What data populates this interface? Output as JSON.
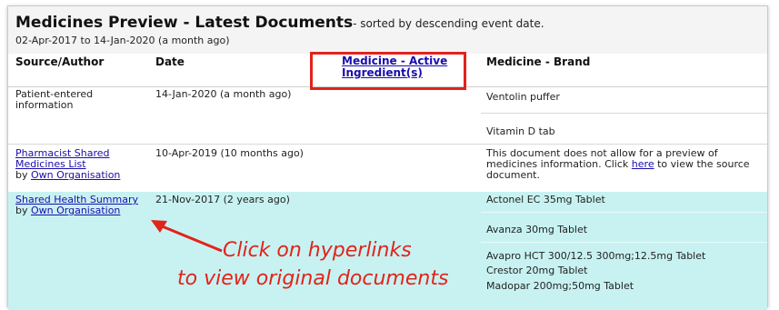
{
  "header": {
    "title": "Medicines Preview - Latest Documents",
    "subtitle": "- sorted by descending event date.",
    "date_range": "02-Apr-2017 to 14-Jan-2020 (a month ago)"
  },
  "columns": {
    "source_author": "Source/Author",
    "date": "Date",
    "active_ingredient_line1": "Medicine - Active",
    "active_ingredient_line2": "Ingredient(s)",
    "brand": "Medicine - Brand"
  },
  "rows": [
    {
      "source_line1": "Patient-entered",
      "source_line2": "information",
      "date": "14-Jan-2020 (a month ago)",
      "brands": [
        "Ventolin puffer",
        "Vitamin D tab"
      ]
    },
    {
      "source_link_line1": "Pharmacist Shared",
      "source_link_line2": "Medicines List",
      "by": "by",
      "org_link": "Own Organisation",
      "date": "10-Apr-2019 (10 months ago)",
      "note_line1": "This document does not allow for a preview of",
      "note_line2_a": "medicines information. Click",
      "note_link": "here",
      "note_line2_b": "to view the source",
      "note_line3": "document."
    },
    {
      "source_link_line1": "Shared Health Summary",
      "by": "by",
      "org_link": "Own Organisation",
      "date": "21-Nov-2017 (2 years ago)",
      "brands": [
        "Actonel EC 35mg Tablet",
        "Avanza 30mg Tablet",
        "Avapro HCT 300/12.5 300mg;12.5mg Tablet",
        "Crestor 20mg Tablet",
        "Madopar 200mg;50mg Tablet"
      ]
    }
  ],
  "annotation": {
    "line1": "Click on hyperlinks",
    "line2": "to view original documents",
    "color": "#e2231a"
  },
  "colors": {
    "highlight_row": "#c8f2f2",
    "link": "#1a0dab",
    "annotation_red": "#e2231a"
  }
}
